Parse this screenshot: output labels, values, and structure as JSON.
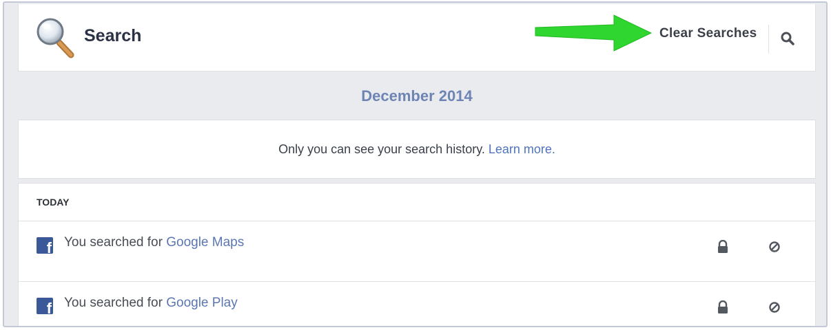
{
  "header": {
    "title": "Search",
    "clear_searches_label": "Clear Searches",
    "logo_icon": "magnifier-icon",
    "search_icon": "search-icon",
    "arrow_color": "#2fd62f"
  },
  "month_heading": "December 2014",
  "notice": {
    "text": "Only you can see your search history. ",
    "link": "Learn more."
  },
  "history": {
    "section_label": "TODAY",
    "items": [
      {
        "prefix": "You searched for ",
        "query": "Google Maps"
      },
      {
        "prefix": "You searched for ",
        "query": "Google Play"
      }
    ]
  },
  "colors": {
    "accent": "#6d84b4",
    "link": "#5b76b2",
    "facebook_blue": "#3b5998",
    "page_bg": "#e9ebee"
  }
}
